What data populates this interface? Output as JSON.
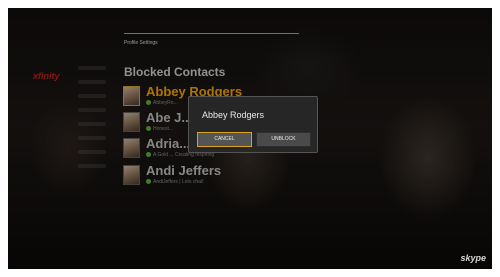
{
  "brand": "xfinity",
  "header": {
    "section": "Profile Settings"
  },
  "page": {
    "title": "Blocked Contacts"
  },
  "contacts": [
    {
      "name": "Abbey Rodgers",
      "status": "AbbeyRo...",
      "selected": true
    },
    {
      "name": "Abe J...",
      "status": "Honest...",
      "selected": false
    },
    {
      "name": "Adria...",
      "status": "A Gold ... Creating Inspiring",
      "selected": false
    },
    {
      "name": "Andi Jeffers",
      "status": "AndiJeffers | Lets chat!",
      "selected": false
    }
  ],
  "dialog": {
    "title": "Abbey Rodgers",
    "cancel_label": "CANCEL",
    "unblock_label": "UNBLOCK"
  },
  "footer": {
    "logo": "skype"
  },
  "colors": {
    "accent": "#f2a400",
    "focus_border": "#d9a21f",
    "status_online": "#5cae3a",
    "brand": "#b8201b"
  }
}
